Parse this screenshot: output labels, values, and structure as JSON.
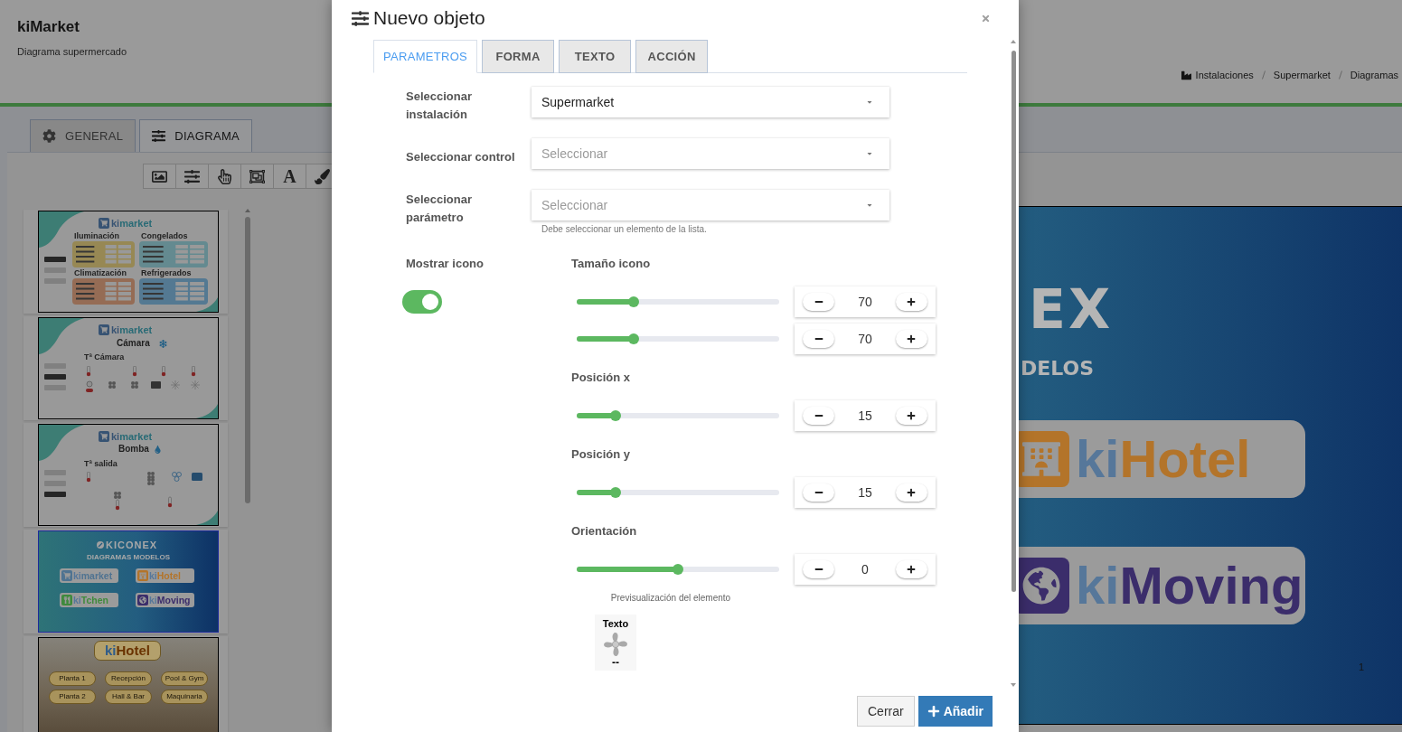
{
  "header": {
    "title": "kiMarket",
    "subtitle": "Diagrama supermercado",
    "breadcrumb": [
      "Instalaciones",
      "Supermarket",
      "Diagramas"
    ]
  },
  "page_tabs": [
    {
      "kind": "settings",
      "label": "GENERAL",
      "selected": false
    },
    {
      "kind": "diagram",
      "label": "DIAGRAMA",
      "selected": true
    }
  ],
  "toolbar": [
    {
      "kind": "image"
    },
    {
      "kind": "sliders"
    },
    {
      "kind": "pointer"
    },
    {
      "kind": "group"
    },
    {
      "kind": "text",
      "label": "A"
    },
    {
      "kind": "brush"
    }
  ],
  "thumbnails": [
    {
      "kind": "dashboard",
      "selected": false,
      "logo": {
        "prefix": "ki",
        "name": "market"
      },
      "menu_buttons": [
        {
          "selected": true
        },
        {
          "selected": false
        },
        {
          "selected": false
        }
      ],
      "panels": [
        {
          "title": "Iluminación",
          "color": "#978854"
        },
        {
          "title": "Congelados",
          "color": "#648a90"
        },
        {
          "title": "Climatización",
          "color": "#956c55"
        },
        {
          "title": "Refrigerados",
          "color": "#547992"
        }
      ]
    },
    {
      "kind": "camera",
      "selected": false,
      "logo": {
        "prefix": "ki",
        "name": "market"
      },
      "menu_buttons": [
        {
          "selected": false
        },
        {
          "selected": true
        },
        {
          "selected": false
        }
      ],
      "title": "Cámara",
      "label": "Tª Cámara"
    },
    {
      "kind": "pump",
      "selected": false,
      "logo": {
        "prefix": "ki",
        "name": "market"
      },
      "menu_buttons": [
        {
          "selected": false
        },
        {
          "selected": false
        },
        {
          "selected": true
        }
      ],
      "title": "Bomba",
      "label": "Tª salida"
    },
    {
      "kind": "cover",
      "selected": true,
      "brand": "KICONEX",
      "subtitle": "DIAGRAMAS MODELOS",
      "apps": [
        {
          "kind": "market",
          "prefix": "ki",
          "name": "market",
          "color": "#4f7391"
        },
        {
          "kind": "hotel",
          "prefix": "ki",
          "name": "Hotel",
          "color": "#b3742a"
        },
        {
          "kind": "kitchen",
          "prefix": "ki",
          "name": "Tchen",
          "color": "#3f8a3c"
        },
        {
          "kind": "moving",
          "prefix": "ki",
          "name": "Moving",
          "color": "#3b2d6b"
        }
      ]
    },
    {
      "kind": "hotel",
      "selected": false,
      "logo": {
        "prefix": "ki",
        "name": "Hotel"
      },
      "buttons": [
        "Planta 1",
        "Recepción",
        "Pool & Gym",
        "Planta 2",
        "Hall & Bar",
        "Maquinaria"
      ]
    }
  ],
  "canvas": {
    "heading": "EX",
    "subheading": "DELOS",
    "apps": [
      {
        "kind": "hotel",
        "prefix": "ki",
        "name": "Hotel",
        "color": "#b3742a"
      },
      {
        "kind": "moving",
        "prefix": "ki",
        "name": "Moving",
        "color": "#3b2d6b"
      }
    ],
    "page_number": "1"
  },
  "modal": {
    "title": "Nuevo objeto",
    "tabs": [
      {
        "label": "PARAMETROS",
        "selected": true
      },
      {
        "label": "FORMA",
        "selected": false
      },
      {
        "label": "TEXTO",
        "selected": false
      },
      {
        "label": "ACCIÓN",
        "selected": false
      }
    ],
    "selects": [
      {
        "label": "Seleccionar instalación",
        "value": "Supermarket"
      },
      {
        "label": "Seleccionar control",
        "placeholder": "Seleccionar"
      },
      {
        "label": "Seleccionar parámetro",
        "placeholder": "Seleccionar",
        "hint": "Debe seleccionar un elemento de la lista."
      }
    ],
    "show_icon": {
      "label": "Mostrar icono",
      "on": true
    },
    "slider_groups": [
      {
        "label": "Tamaño icono",
        "sliders": [
          {
            "level": 0.28,
            "value": "70"
          },
          {
            "level": 0.28,
            "value": "70"
          }
        ]
      },
      {
        "label": "Posición x",
        "sliders": [
          {
            "level": 0.19,
            "value": "15"
          }
        ]
      },
      {
        "label": "Posición y",
        "sliders": [
          {
            "level": 0.19,
            "value": "15"
          }
        ]
      },
      {
        "label": "Orientación",
        "sliders": [
          {
            "level": 0.5,
            "value": "0"
          }
        ]
      }
    ],
    "preview": {
      "caption": "Previsualización del elemento",
      "label": "Texto",
      "value": "--"
    },
    "buttons": [
      {
        "kind": "secondary",
        "label": "Cerrar"
      },
      {
        "kind": "primary",
        "label": "Añadir"
      }
    ]
  }
}
